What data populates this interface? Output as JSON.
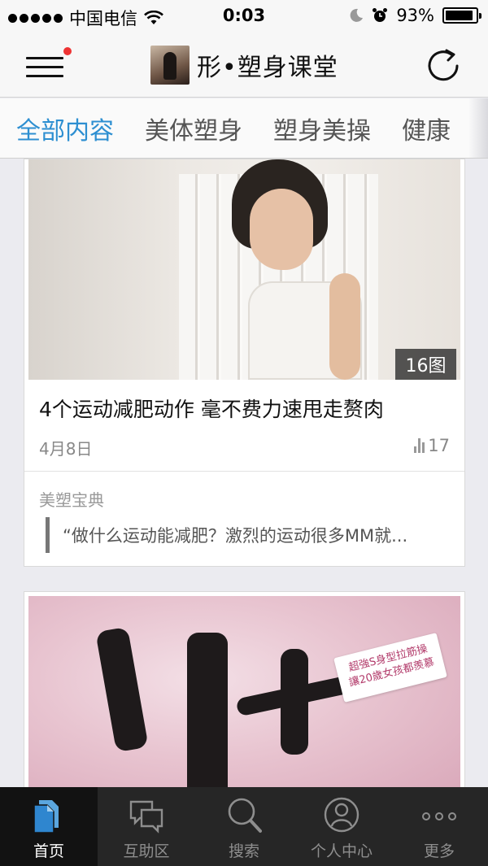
{
  "status_bar": {
    "carrier": "中国电信",
    "time": "0:03",
    "battery": "93%",
    "battery_level": 0.93
  },
  "nav": {
    "title": "形•塑身课堂"
  },
  "category_tabs": [
    {
      "label": "全部内容",
      "active": true
    },
    {
      "label": "美体塑身",
      "active": false
    },
    {
      "label": "塑身美操",
      "active": false
    },
    {
      "label": "健康",
      "active": false
    }
  ],
  "feed": {
    "article1": {
      "image_count": "16图",
      "headline": "4个运动减肥动作 毫不费力速甩走赘肉",
      "date": "4月8日",
      "views": "17",
      "section_label": "美塑宝典",
      "quote": "“做什么运动能减肥？激烈的运动很多MM就..."
    },
    "article2": {
      "promo_line1": "超強S身型拉筋操",
      "promo_line2": "讓20歲女孩都羨慕"
    }
  },
  "tabbar": [
    {
      "label": "首页",
      "icon": "home-docs-icon",
      "active": true
    },
    {
      "label": "互助区",
      "icon": "chat-bubbles-icon",
      "active": false
    },
    {
      "label": "搜索",
      "icon": "search-icon",
      "active": false
    },
    {
      "label": "个人中心",
      "icon": "user-icon",
      "active": false
    },
    {
      "label": "更多",
      "icon": "more-dots-icon",
      "active": false
    }
  ],
  "colors": {
    "accent": "#2d8fd1",
    "tabbar_bg": "#262626",
    "notification_dot": "#e33333"
  }
}
